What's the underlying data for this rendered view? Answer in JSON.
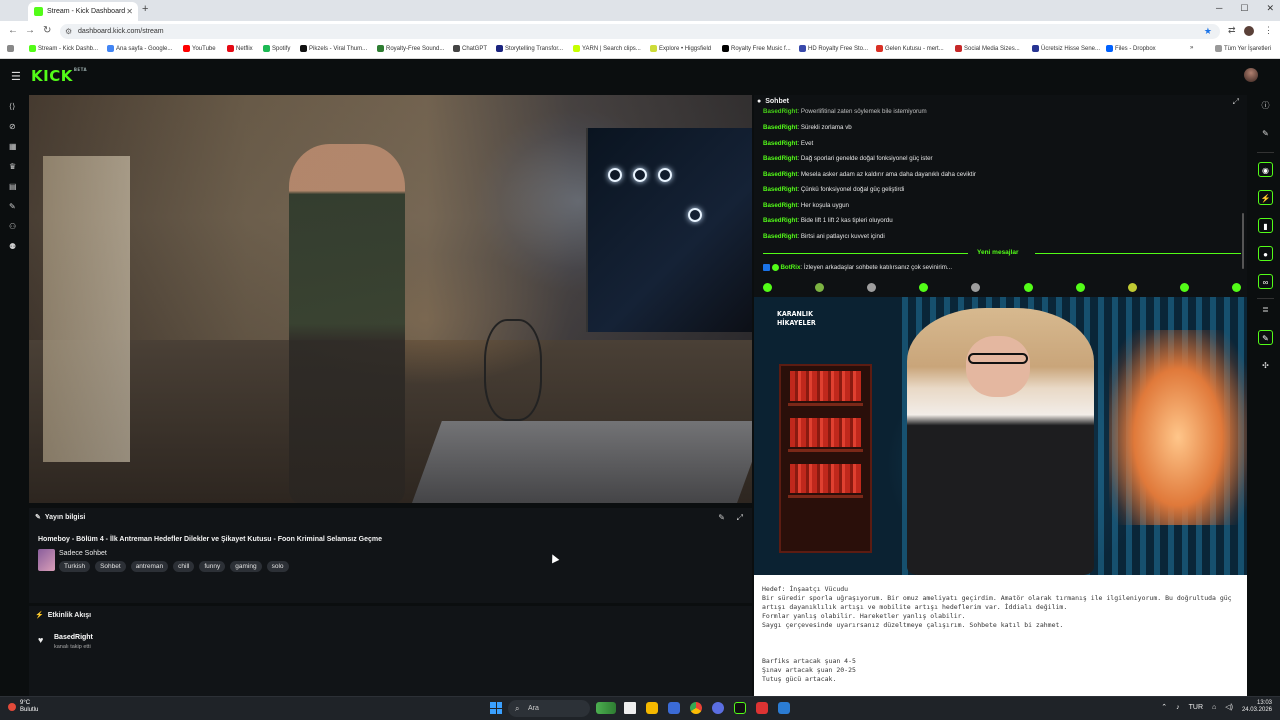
{
  "browser": {
    "tab_title": "Stream - Kick Dashboard",
    "url": "dashboard.kick.com/stream",
    "bookmarks": [
      "Stream - Kick Dashb...",
      "Ana sayfa - Google...",
      "YouTube",
      "Netflix",
      "Spotify",
      "Pikzels - Viral Thum...",
      "Royalty-Free Sound...",
      "ChatGPT",
      "Storytelling Transfor...",
      "YARN | Search clips...",
      "Explore • Higgsfield",
      "Royalty Free Music f...",
      "HD Royalty Free Sto...",
      "Gelen Kutusu - mert...",
      "Social Media Sizes...",
      "Ücretsiz Hisse Sene...",
      "Files - Dropbox"
    ],
    "all_bookmarks": "Tüm Yer İşaretleri"
  },
  "kick": {
    "logo": "KICK",
    "logo_beta": "BETA"
  },
  "stream_info": {
    "header": "Yayın bilgisi",
    "title": "Homeboy - Bölüm 4 - İlk Antreman Hedefler Dilekler ve Şikayet Kutusu - Foon Kriminal Selamsız Geçme",
    "category": "Sadece Sohbet",
    "tags": [
      "Turkish",
      "Sohbet",
      "antreman",
      "chill",
      "funny",
      "gaming",
      "solo"
    ]
  },
  "activity": {
    "header": "Etkinlik Akışı",
    "user": "BasedRight",
    "action": "kanalı takip etti"
  },
  "chat": {
    "header": "Sohbet",
    "messages": [
      {
        "user": "BasedRight",
        "text": "Powerlifitinal zaten söylemek bile istemiyorum"
      },
      {
        "user": "BasedRight",
        "text": "Sürekli zorlama vb"
      },
      {
        "user": "BasedRight",
        "text": "Evet"
      },
      {
        "user": "BasedRight",
        "text": "Dağ sporlari genelde doğal fonksiyonel güç ister"
      },
      {
        "user": "BasedRight",
        "text": "Mesela asker adam az kaldırır ama daha dayanıklı daha ceviktir"
      },
      {
        "user": "BasedRight",
        "text": "Çünkü fonksiyonel doğal güç geliştirdi"
      },
      {
        "user": "BasedRight",
        "text": "Her koşula uygun"
      },
      {
        "user": "BasedRight",
        "text": "Bide lift 1 lift 2 kas tipleri oluyordu"
      },
      {
        "user": "BasedRight",
        "text": "Birtsi ani patlayıcı kuvvet içindi"
      }
    ],
    "new_messages": "Yeni mesajlar",
    "bot": {
      "user": "BotRix",
      "text": "İzleyen arkadaşlar sohbete katılırsanız çok sevinirim..."
    }
  },
  "pip": {
    "brand_line1": "KARANLIK",
    "brand_line2": "HİKAYELER"
  },
  "notes": {
    "lines": [
      "Hedef: İnşaatçı Vücudu",
      "Bir süredir sporla uğraşıyorum. Bir omuz ameliyatı geçirdim. Amatör olarak tırmanış ile ilgileniyorum. Bu doğrultuda güç",
      "artışı dayanıklılık artışı ve mobilite artışı hedeflerim var. İddialı değilim.",
      "Formlar yanlış olabilir. Hareketler yanlış olabilir.",
      "Saygı çerçevesinde uyarırsanız düzeltmeye çalışırım. Sohbete katıl bi zahmet.",
      "Barfiks artacak şuan 4-5",
      "Şınav artacak  şuan 20-25",
      "Tutuş gücü artacak."
    ]
  },
  "taskbar": {
    "weather_temp": "9°C",
    "weather_desc": "Bulutlu",
    "search": "Ara",
    "lang": "TUR",
    "time": "13:03",
    "date": "24.03.2026"
  }
}
